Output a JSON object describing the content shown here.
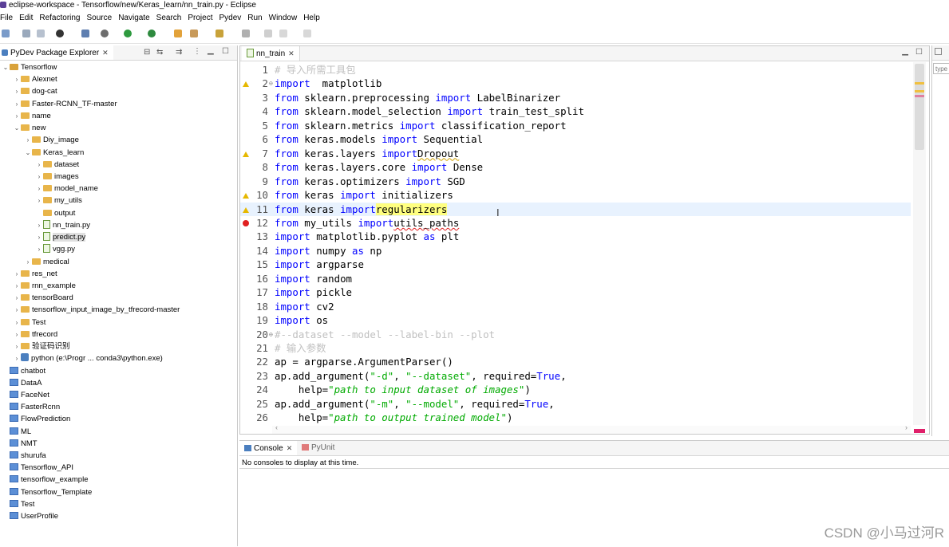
{
  "window": {
    "title": "eclipse-workspace - Tensorflow/new/Keras_learn/nn_train.py - Eclipse"
  },
  "menu": [
    "File",
    "Edit",
    "Refactoring",
    "Source",
    "Navigate",
    "Search",
    "Project",
    "Pydev",
    "Run",
    "Window",
    "Help"
  ],
  "left_view": {
    "title": "PyDev Package Explorer"
  },
  "tree": [
    {
      "label": "Tensorflow",
      "type": "proj",
      "level": 0,
      "expand": "open"
    },
    {
      "label": "Alexnet",
      "type": "folder",
      "level": 1,
      "expand": "closed"
    },
    {
      "label": "dog-cat",
      "type": "folder",
      "level": 1,
      "expand": "closed"
    },
    {
      "label": "Faster-RCNN_TF-master",
      "type": "folder",
      "level": 1,
      "expand": "closed"
    },
    {
      "label": "name",
      "type": "folder",
      "level": 1,
      "expand": "closed"
    },
    {
      "label": "new",
      "type": "folder",
      "level": 1,
      "expand": "open"
    },
    {
      "label": "Diy_image",
      "type": "folder",
      "level": 2,
      "expand": "closed"
    },
    {
      "label": "Keras_learn",
      "type": "folder",
      "level": 2,
      "expand": "open"
    },
    {
      "label": "dataset",
      "type": "folder",
      "level": 3,
      "expand": "closed"
    },
    {
      "label": "images",
      "type": "folder",
      "level": 3,
      "expand": "closed"
    },
    {
      "label": "model_name",
      "type": "folder",
      "level": 3,
      "expand": "closed"
    },
    {
      "label": "my_utils",
      "type": "folder",
      "level": 3,
      "expand": "closed"
    },
    {
      "label": "output",
      "type": "folder",
      "level": 3,
      "expand": "none"
    },
    {
      "label": "nn_train.py",
      "type": "py",
      "level": 3,
      "expand": "closed"
    },
    {
      "label": "predict.py",
      "type": "py",
      "level": 3,
      "expand": "closed",
      "selected": true
    },
    {
      "label": "vgg.py",
      "type": "py",
      "level": 3,
      "expand": "closed"
    },
    {
      "label": "medical",
      "type": "folder",
      "level": 2,
      "expand": "closed"
    },
    {
      "label": "res_net",
      "type": "folder",
      "level": 1,
      "expand": "closed"
    },
    {
      "label": "rnn_example",
      "type": "folder",
      "level": 1,
      "expand": "closed"
    },
    {
      "label": "tensorBoard",
      "type": "folder",
      "level": 1,
      "expand": "closed"
    },
    {
      "label": "tensorflow_input_image_by_tfrecord-master",
      "type": "folder",
      "level": 1,
      "expand": "closed"
    },
    {
      "label": "Test",
      "type": "folder",
      "level": 1,
      "expand": "closed"
    },
    {
      "label": "tfrecord",
      "type": "folder",
      "level": 1,
      "expand": "closed"
    },
    {
      "label": "验证码识别",
      "type": "folder",
      "level": 1,
      "expand": "closed"
    },
    {
      "label": "python  (e:\\Progr ... conda3\\python.exe)",
      "type": "interp",
      "level": 1,
      "expand": "closed"
    },
    {
      "label": "chatbot",
      "type": "project",
      "level": 0,
      "expand": "none"
    },
    {
      "label": "DataA",
      "type": "project",
      "level": 0,
      "expand": "none"
    },
    {
      "label": "FaceNet",
      "type": "project",
      "level": 0,
      "expand": "none"
    },
    {
      "label": "FasterRcnn",
      "type": "project",
      "level": 0,
      "expand": "none"
    },
    {
      "label": "FlowPrediction",
      "type": "project",
      "level": 0,
      "expand": "none"
    },
    {
      "label": "ML",
      "type": "project",
      "level": 0,
      "expand": "none"
    },
    {
      "label": "NMT",
      "type": "project",
      "level": 0,
      "expand": "none"
    },
    {
      "label": "shurufa",
      "type": "project",
      "level": 0,
      "expand": "none"
    },
    {
      "label": "Tensorflow_API",
      "type": "project",
      "level": 0,
      "expand": "none"
    },
    {
      "label": "tensorflow_example",
      "type": "project",
      "level": 0,
      "expand": "none"
    },
    {
      "label": "Tensorflow_Template",
      "type": "project",
      "level": 0,
      "expand": "none"
    },
    {
      "label": "Test",
      "type": "project",
      "level": 0,
      "expand": "none"
    },
    {
      "label": "UserProfile",
      "type": "project",
      "level": 0,
      "expand": "none"
    }
  ],
  "editor": {
    "tab_label": "nn_train",
    "current_line": 11,
    "lines": [
      {
        "n": "1",
        "marker": "",
        "segs": [
          [
            "cmt",
            "# 导入所需工具包"
          ]
        ]
      },
      {
        "n": "2",
        "marker": "warn",
        "fold": true,
        "segs": [
          [
            "kw",
            "import"
          ],
          [
            "",
            "  matplotlib"
          ]
        ]
      },
      {
        "n": "3",
        "marker": "",
        "segs": [
          [
            "kw",
            "from"
          ],
          [
            "",
            " sklearn.preprocessing "
          ],
          [
            "kw",
            "import"
          ],
          [
            "",
            " LabelBinarizer"
          ]
        ]
      },
      {
        "n": "4",
        "marker": "",
        "segs": [
          [
            "kw",
            "from"
          ],
          [
            "",
            " sklearn.model_selection "
          ],
          [
            "kw",
            "import"
          ],
          [
            "",
            " train_test_split"
          ]
        ]
      },
      {
        "n": "5",
        "marker": "",
        "segs": [
          [
            "kw",
            "from"
          ],
          [
            "",
            " sklearn.metrics "
          ],
          [
            "kw",
            "import"
          ],
          [
            "",
            " classification_report"
          ]
        ]
      },
      {
        "n": "6",
        "marker": "",
        "segs": [
          [
            "kw",
            "from"
          ],
          [
            "",
            " keras.models "
          ],
          [
            "kw",
            "import"
          ],
          [
            "",
            " Sequential"
          ]
        ]
      },
      {
        "n": "7",
        "marker": "warn",
        "segs": [
          [
            "kw",
            "from"
          ],
          [
            "",
            " keras.layers "
          ],
          [
            "kw",
            "import"
          ],
          [
            " ",
            ""
          ],
          [
            "squigy",
            "Dropout"
          ]
        ]
      },
      {
        "n": "8",
        "marker": "",
        "segs": [
          [
            "kw",
            "from"
          ],
          [
            "",
            " keras.layers.core "
          ],
          [
            "kw",
            "import"
          ],
          [
            "",
            " Dense"
          ]
        ]
      },
      {
        "n": "9",
        "marker": "",
        "segs": [
          [
            "kw",
            "from"
          ],
          [
            "",
            " keras.optimizers "
          ],
          [
            "kw",
            "import"
          ],
          [
            "",
            " SGD"
          ]
        ]
      },
      {
        "n": "10",
        "marker": "warn",
        "segs": [
          [
            "kw",
            "from"
          ],
          [
            "",
            " keras "
          ],
          [
            "kw",
            "import"
          ],
          [
            "",
            " initializers"
          ]
        ]
      },
      {
        "n": "11",
        "marker": "warn",
        "segs": [
          [
            "kw",
            "from"
          ],
          [
            "",
            " keras "
          ],
          [
            "kw",
            "import"
          ],
          [
            " ",
            ""
          ],
          [
            "hl",
            "regularizers"
          ]
        ]
      },
      {
        "n": "12",
        "marker": "err",
        "segs": [
          [
            "kw",
            "from"
          ],
          [
            "",
            " my_utils "
          ],
          [
            "kw",
            "import"
          ],
          [
            " ",
            ""
          ],
          [
            "squig",
            "utils_paths"
          ]
        ]
      },
      {
        "n": "13",
        "marker": "",
        "segs": [
          [
            "kw",
            "import"
          ],
          [
            "",
            " matplotlib.pyplot "
          ],
          [
            "kw",
            "as"
          ],
          [
            "",
            " plt"
          ]
        ]
      },
      {
        "n": "14",
        "marker": "",
        "segs": [
          [
            "kw",
            "import"
          ],
          [
            "",
            " numpy "
          ],
          [
            "kw",
            "as"
          ],
          [
            "",
            " np"
          ]
        ]
      },
      {
        "n": "15",
        "marker": "",
        "segs": [
          [
            "kw",
            "import"
          ],
          [
            "",
            " argparse"
          ]
        ]
      },
      {
        "n": "16",
        "marker": "",
        "segs": [
          [
            "kw",
            "import"
          ],
          [
            "",
            " random"
          ]
        ]
      },
      {
        "n": "17",
        "marker": "",
        "segs": [
          [
            "kw",
            "import"
          ],
          [
            "",
            " pickle"
          ]
        ]
      },
      {
        "n": "18",
        "marker": "",
        "segs": [
          [
            "kw",
            "import"
          ],
          [
            "",
            " cv2"
          ]
        ]
      },
      {
        "n": "19",
        "marker": "",
        "segs": [
          [
            "kw",
            "import"
          ],
          [
            "",
            " os"
          ]
        ]
      },
      {
        "n": "20",
        "marker": "",
        "fold": true,
        "segs": [
          [
            "cmt",
            "#--dataset --model --label-bin --plot"
          ]
        ]
      },
      {
        "n": "21",
        "marker": "",
        "segs": [
          [
            "cmt",
            "# 输入参数"
          ]
        ]
      },
      {
        "n": "22",
        "marker": "",
        "segs": [
          [
            "",
            "ap = argparse.ArgumentParser()"
          ]
        ]
      },
      {
        "n": "23",
        "marker": "",
        "segs": [
          [
            "",
            "ap.add_argument("
          ],
          [
            "str",
            "\"-d\""
          ],
          [
            "",
            ", "
          ],
          [
            "str",
            "\"--dataset\""
          ],
          [
            "",
            ", required="
          ],
          [
            "kw",
            "True"
          ],
          [
            "",
            ","
          ]
        ]
      },
      {
        "n": "24",
        "marker": "",
        "segs": [
          [
            "",
            "    help="
          ],
          [
            "istr",
            "\"path to input dataset of images\""
          ],
          [
            "",
            ")"
          ]
        ]
      },
      {
        "n": "25",
        "marker": "",
        "segs": [
          [
            "",
            "ap.add_argument("
          ],
          [
            "str",
            "\"-m\""
          ],
          [
            "",
            ", "
          ],
          [
            "str",
            "\"--model\""
          ],
          [
            "",
            ", required="
          ],
          [
            "kw",
            "True"
          ],
          [
            "",
            ","
          ]
        ]
      },
      {
        "n": "26",
        "marker": "",
        "segs": [
          [
            "",
            "    help="
          ],
          [
            "istr",
            "\"path to output trained model\""
          ],
          [
            "",
            ")"
          ]
        ]
      }
    ]
  },
  "console": {
    "tabs": [
      "Console",
      "PyUnit"
    ],
    "message": "No consoles to display at this time."
  },
  "right_view": {
    "placeholder": "type"
  },
  "watermark": "CSDN @小马过河R"
}
